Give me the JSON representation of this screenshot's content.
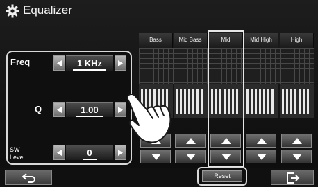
{
  "title": {
    "text": "Equalizer",
    "icon": "gear-icon"
  },
  "params": [
    {
      "label": "Freq",
      "value": "1 KHz"
    },
    {
      "label": "Q",
      "value": "1.00"
    },
    {
      "label": "SW Level",
      "label_line1": "SW",
      "label_line2": "Level",
      "value": "0"
    }
  ],
  "bands": [
    {
      "name": "Bass",
      "ticks": [
        "",
        ""
      ]
    },
    {
      "name": "Mid Bass",
      "ticks": [
        "",
        ""
      ]
    },
    {
      "name": "Mid",
      "ticks": [
        "",
        ""
      ]
    },
    {
      "name": "Mid High",
      "ticks": [
        "",
        ""
      ]
    },
    {
      "name": "High",
      "ticks": [
        "",
        ""
      ]
    }
  ],
  "selected_band": "Mid",
  "buttons": {
    "reset": "Reset",
    "back_icon": "back-arrow-icon",
    "exit_icon": "exit-icon"
  },
  "colors": {
    "background": "#111111",
    "highlight": "#e6e6e6"
  }
}
